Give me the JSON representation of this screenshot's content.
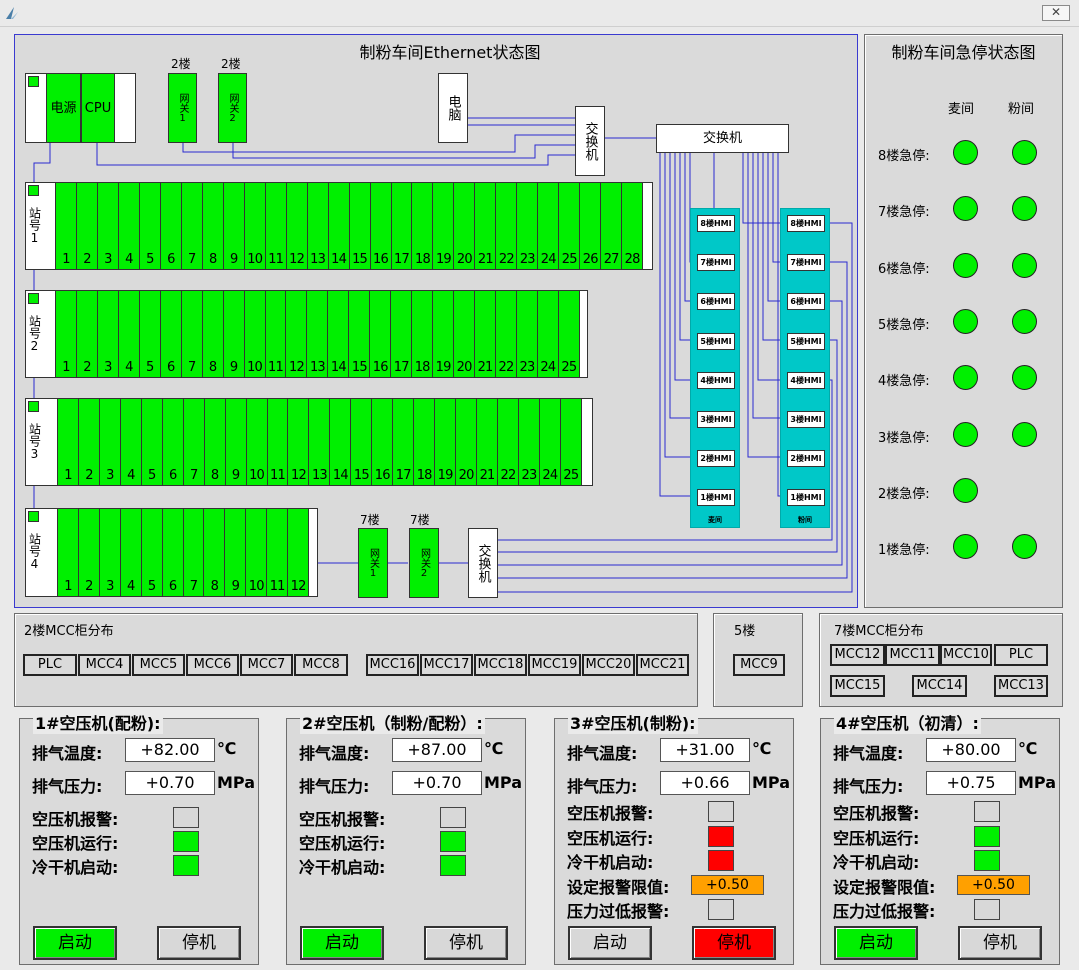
{
  "eth": {
    "title": "制粉车间Ethernet状态图",
    "psu": "电源",
    "cpu": "CPU",
    "gw_top_floor": "2楼",
    "gw_bottom_floor": "7楼",
    "gw1": "网关1",
    "gw2": "网关2",
    "pc": "电脑",
    "switch_small": "交换机",
    "switch_main": "交换机",
    "stations": [
      {
        "label": "站号1",
        "slots": [
          "1",
          "2",
          "3",
          "4",
          "5",
          "6",
          "7",
          "8",
          "9",
          "10",
          "11",
          "12",
          "13",
          "14",
          "15",
          "16",
          "17",
          "18",
          "19",
          "20",
          "21",
          "22",
          "23",
          "24",
          "25",
          "26",
          "27",
          "28"
        ]
      },
      {
        "label": "站号2",
        "slots": [
          "1",
          "2",
          "3",
          "4",
          "5",
          "6",
          "7",
          "8",
          "9",
          "10",
          "11",
          "12",
          "13",
          "14",
          "15",
          "16",
          "17",
          "18",
          "19",
          "20",
          "21",
          "22",
          "23",
          "24",
          "25"
        ]
      },
      {
        "label": "站号3",
        "slots": [
          "1",
          "2",
          "3",
          "4",
          "5",
          "6",
          "7",
          "8",
          "9",
          "10",
          "11",
          "12",
          "13",
          "14",
          "15",
          "16",
          "17",
          "18",
          "19",
          "20",
          "21",
          "22",
          "23",
          "24",
          "25"
        ]
      },
      {
        "label": "站号4",
        "slots": [
          "1",
          "2",
          "3",
          "4",
          "5",
          "6",
          "7",
          "8",
          "9",
          "10",
          "11",
          "12"
        ]
      }
    ],
    "hmi_left_label": "麦间",
    "hmi_right_label": "粉间",
    "hmis": [
      "8楼HMI",
      "7楼HMI",
      "6楼HMI",
      "5楼HMI",
      "4楼HMI",
      "3楼HMI",
      "2楼HMI",
      "1楼HMI"
    ]
  },
  "estop": {
    "title": "制粉车间急停状态图",
    "col1": "麦间",
    "col2": "粉间",
    "rows": [
      {
        "label": "8楼急停:",
        "wheat": true,
        "flour": true
      },
      {
        "label": "7楼急停:",
        "wheat": true,
        "flour": true
      },
      {
        "label": "6楼急停:",
        "wheat": true,
        "flour": true
      },
      {
        "label": "5楼急停:",
        "wheat": true,
        "flour": true
      },
      {
        "label": "4楼急停:",
        "wheat": true,
        "flour": true
      },
      {
        "label": "3楼急停:",
        "wheat": true,
        "flour": true
      },
      {
        "label": "2楼急停:",
        "wheat": true,
        "flour": false
      },
      {
        "label": "1楼急停:",
        "wheat": true,
        "flour": true
      }
    ]
  },
  "mcc2": {
    "title": "2楼MCC柜分布",
    "groupA": [
      "PLC",
      "MCC4",
      "MCC5",
      "MCC6",
      "MCC7",
      "MCC8"
    ],
    "groupB": [
      "MCC16",
      "MCC17",
      "MCC18",
      "MCC19",
      "MCC20",
      "MCC21"
    ]
  },
  "mcc5": {
    "title": "5楼",
    "items": [
      "MCC9"
    ]
  },
  "mcc7": {
    "title": "7楼MCC柜分布",
    "row1": [
      "MCC12",
      "MCC11",
      "MCC10",
      "PLC"
    ],
    "row2": [
      "MCC15",
      "MCC14",
      "MCC13"
    ]
  },
  "labels": {
    "exhaust_temp": "排气温度:",
    "exhaust_press": "排气压力:",
    "alarm": "空压机报警:",
    "running": "空压机运行:",
    "dryer": "冷干机启动:",
    "limit": "设定报警限值:",
    "low_press": "压力过低报警:",
    "unit_temp": "℃",
    "unit_press": "MPa",
    "start": "启动",
    "stop": "停机"
  },
  "compressors": [
    {
      "title": "1#空压机(配粉):",
      "temp": "+82.00",
      "press": "+0.70",
      "alarm": "#d8d8d8",
      "running": "#00f000",
      "dryer": "#00f000"
    },
    {
      "title": "2#空压机（制粉/配粉）:",
      "temp": "+87.00",
      "press": "+0.70",
      "alarm": "#d8d8d8",
      "running": "#00f000",
      "dryer": "#00f000"
    },
    {
      "title": "3#空压机(制粉):",
      "temp": "+31.00",
      "press": "+0.66",
      "alarm": "#d8d8d8",
      "running": "#ff0000",
      "dryer": "#ff0000",
      "limit": "+0.50",
      "low": "#d8d8d8"
    },
    {
      "title": "4#空压机（初清）:",
      "temp": "+80.00",
      "press": "+0.75",
      "alarm": "#d8d8d8",
      "running": "#00f000",
      "dryer": "#00f000",
      "limit": "+0.50",
      "low": "#d8d8d8"
    }
  ],
  "colors": {
    "ok": "#00f000",
    "fault": "#ff0000",
    "limit": "#ffa000",
    "hmi_bar": "#00c8c8",
    "wire": "#2a2ad0"
  }
}
